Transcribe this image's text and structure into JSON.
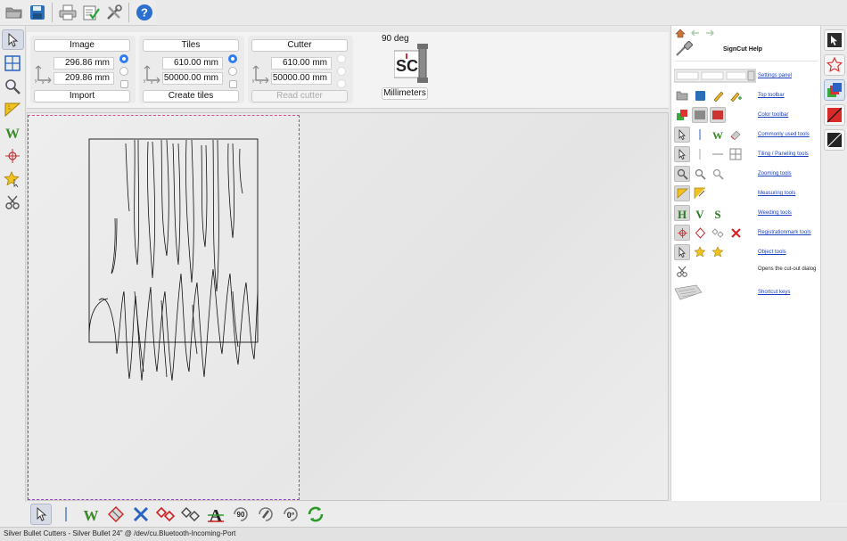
{
  "status_bar": {
    "text": "Silver Bullet Cutters - Silver Bullet 24\" @ /dev/cu.Bluetooth-Incoming-Port"
  },
  "top_toolbar": {
    "icons": [
      "open-folder-icon",
      "save-disk-icon",
      "print-icon",
      "cut-checklist-icon",
      "tools-icon",
      "help-question-icon"
    ]
  },
  "left_toolbar": {
    "icons": [
      "pointer-icon",
      "tiling-grid-icon",
      "zoom-icon",
      "measure-ruler-icon",
      "weed-w-icon",
      "registration-mark-icon",
      "object-star-icon",
      "cut-scissors-icon"
    ]
  },
  "settings_panel": {
    "image": {
      "button_label": "Image",
      "width_value": "296.86 mm",
      "height_value": "209.86 mm",
      "action_label": "Import"
    },
    "tiles": {
      "button_label": "Tiles",
      "width_value": "610.00 mm",
      "height_value": "50000.00 mm",
      "action_label": "Create tiles"
    },
    "cutter": {
      "button_label": "Cutter",
      "width_value": "610.00 mm",
      "height_value": "50000.00 mm",
      "action_label": "Read cutter"
    },
    "orientation": {
      "label": "90 deg",
      "logo_text": "SC"
    },
    "units": {
      "label": "Millimeters"
    }
  },
  "help_panel": {
    "title": "SignCut Help",
    "rows": [
      {
        "label": "Settings panel",
        "type": "link"
      },
      {
        "label": "Top toolbar",
        "type": "link"
      },
      {
        "label": "Color toolbar",
        "type": "link"
      },
      {
        "label": "Commonly used tools",
        "type": "link"
      },
      {
        "label": "Tiling / Paneling tools",
        "type": "link"
      },
      {
        "label": "Zooming tools",
        "type": "link"
      },
      {
        "label": "Measuring tools",
        "type": "link"
      },
      {
        "label": "Weeding tools",
        "type": "link"
      },
      {
        "label": "Registrationmark tools",
        "type": "link"
      },
      {
        "label": "Object tools",
        "type": "link"
      },
      {
        "label": "Opens the cut-out dialog",
        "type": "text"
      },
      {
        "label": "Shortcut keys",
        "type": "link"
      }
    ]
  },
  "right_toolbar": {
    "icons": [
      "select-tool-icon",
      "star-outline-icon",
      "color-layers-icon",
      "red-line-color-icon",
      "black-line-color-icon"
    ]
  },
  "bottom_toolbar": {
    "icons": [
      "pointer-icon",
      "weed-w-icon",
      "weed-border-icon",
      "delete-x-icon",
      "reg-mark-red-icon",
      "reg-mark-outline-icon",
      "text-a-icon",
      "rotate-90-icon",
      "mirror-icon",
      "rotate-0-icon",
      "refresh-icon"
    ],
    "rotate_90_label": "90",
    "rotate_0_label": "0°"
  },
  "colors": {
    "accent_blue": "#2e7cf6",
    "media_border": "#9a3ec2",
    "help_link": "#1b3fc2"
  }
}
